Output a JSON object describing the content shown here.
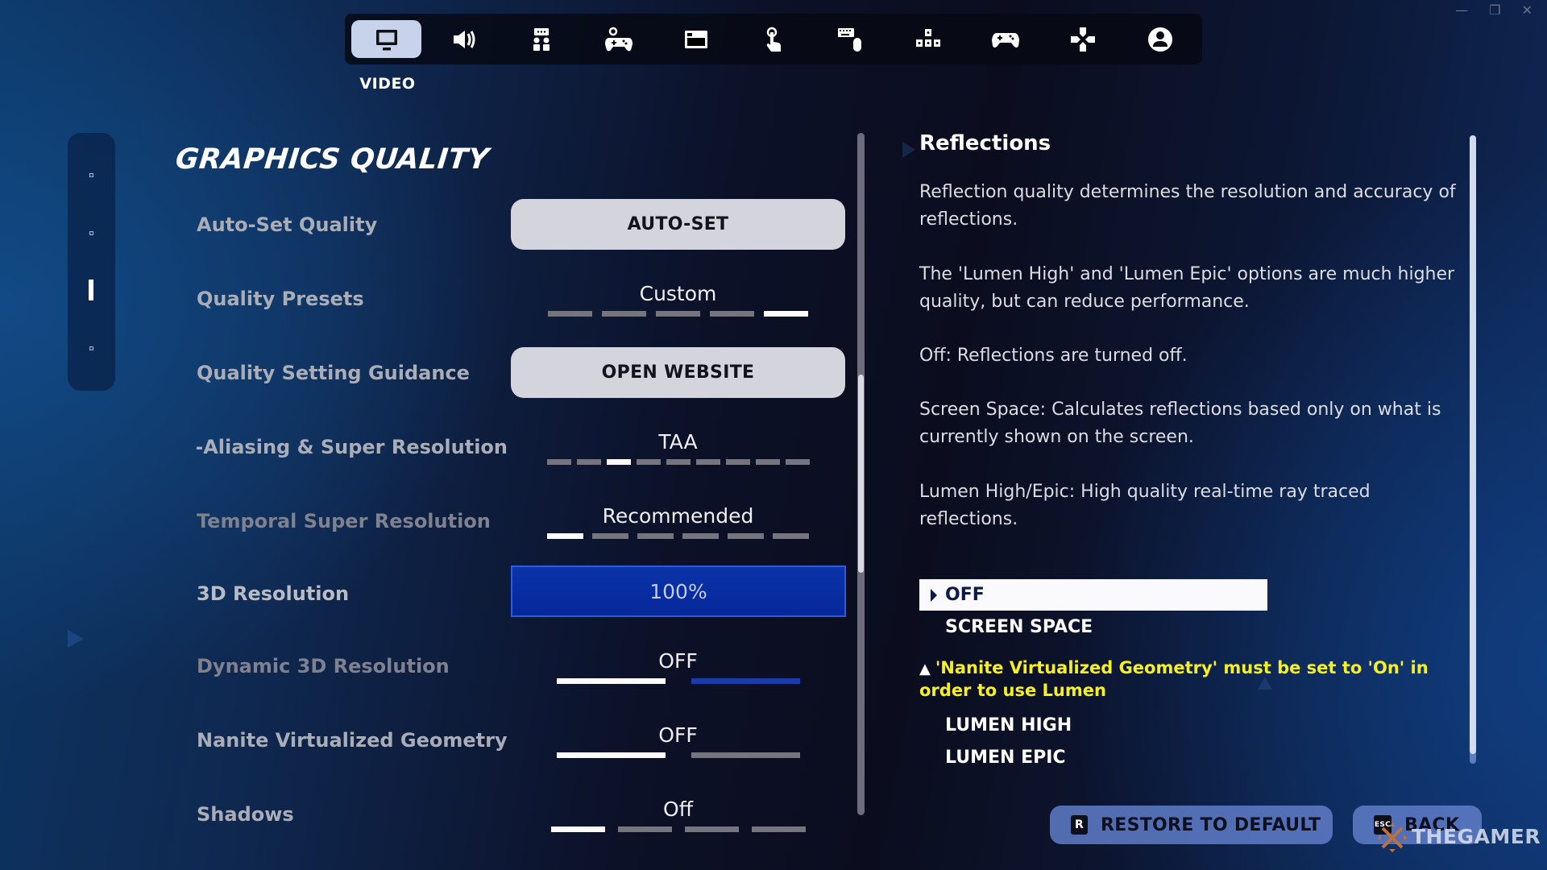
{
  "window_controls": {
    "minimize": "—",
    "maximize": "❐",
    "close": "✕"
  },
  "topnav": {
    "active_label": "VIDEO",
    "tabs": [
      {
        "id": "video",
        "icon": "monitor-icon",
        "active": true
      },
      {
        "id": "audio",
        "icon": "speaker-icon",
        "active": false
      },
      {
        "id": "accessibility",
        "icon": "accessibility-icon",
        "active": false
      },
      {
        "id": "game",
        "icon": "controller-gear-icon",
        "active": false
      },
      {
        "id": "hud",
        "icon": "window-layout-icon",
        "active": false
      },
      {
        "id": "touch",
        "icon": "touch-icon",
        "active": false
      },
      {
        "id": "keyboard-mouse",
        "icon": "keyboard-mouse-icon",
        "active": false
      },
      {
        "id": "keybinds",
        "icon": "keycaps-icon",
        "active": false
      },
      {
        "id": "controller",
        "icon": "gamepad-icon",
        "active": false
      },
      {
        "id": "controller-binds",
        "icon": "dpad-icon",
        "active": false
      },
      {
        "id": "account",
        "icon": "account-icon",
        "active": false
      }
    ]
  },
  "side_rail": {
    "sections": 4,
    "active_index": 2
  },
  "settings": {
    "section_title": "GRAPHICS QUALITY",
    "rows": [
      {
        "label": "Auto-Set Quality",
        "type": "button",
        "value": "AUTO-SET"
      },
      {
        "label": "Quality Presets",
        "type": "selector",
        "value": "Custom",
        "options_count": 5,
        "selected_index": 4
      },
      {
        "label": "Quality Setting Guidance",
        "type": "button",
        "value": "OPEN WEBSITE"
      },
      {
        "label": "Anti-Aliasing & Super Resolution",
        "type": "selector",
        "value": "TAA",
        "options_count": 9,
        "selected_index": 2
      },
      {
        "label": "Temporal Super Resolution",
        "type": "selector",
        "value": "Recommended",
        "options_count": 6,
        "selected_index": 0
      },
      {
        "label": "3D Resolution",
        "type": "slider",
        "value": "100%",
        "percent": 100
      },
      {
        "label": "Dynamic 3D Resolution",
        "type": "toggle",
        "value": "OFF",
        "options_count": 2,
        "selected_index": 0
      },
      {
        "label": "Nanite Virtualized Geometry",
        "type": "toggle",
        "value": "OFF",
        "options_count": 2,
        "selected_index": 0
      },
      {
        "label": "Shadows",
        "type": "selector",
        "value": "Off",
        "options_count": 4,
        "selected_index": 0
      }
    ],
    "scroll_position_fraction": 0.38
  },
  "description": {
    "title": "Reflections",
    "paragraphs": [
      "Reflection quality determines the resolution and accuracy of reflections.",
      "The 'Lumen High' and 'Lumen Epic' options are much higher quality, but can reduce performance.",
      "Off: Reflections are turned off.",
      "Screen Space: Calculates reflections based only on what is currently shown on the screen.",
      "Lumen High/Epic: High quality real-time ray traced reflections."
    ],
    "options": [
      {
        "label": "OFF",
        "selected": true
      },
      {
        "label": "SCREEN SPACE",
        "selected": false
      },
      {
        "label": "LUMEN HIGH",
        "selected": false
      },
      {
        "label": "LUMEN EPIC",
        "selected": false
      }
    ],
    "warning": "'Nanite Virtualized Geometry' must be set to 'On' in order to use Lumen"
  },
  "footer": {
    "restore": {
      "key": "R",
      "label": "RESTORE TO DEFAULT"
    },
    "back": {
      "key": "ESC",
      "label": "BACK"
    },
    "watermark": "THEGAMER"
  },
  "colors": {
    "accent_blue": "#0a34a8",
    "warning_yellow": "#f6f023",
    "tick_active": "#fbfbfd",
    "tick_inactive": "#75757f"
  }
}
